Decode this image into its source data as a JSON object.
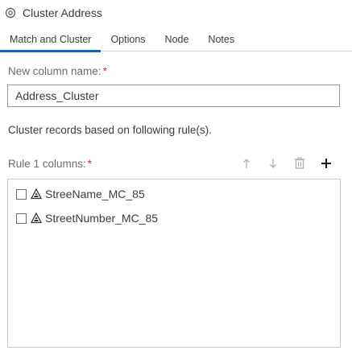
{
  "header": {
    "title": "Cluster Address",
    "icon": "cluster-node-icon"
  },
  "tabs": [
    {
      "label": "Match and Cluster",
      "active": true
    },
    {
      "label": "Options",
      "active": false
    },
    {
      "label": "Node",
      "active": false
    },
    {
      "label": "Notes",
      "active": false
    }
  ],
  "form": {
    "column_name_label": "New column name:",
    "column_name_value": "Address_Cluster",
    "required_mark": "*",
    "description": "Cluster records based on following rule(s).",
    "rule_label": "Rule 1 columns:",
    "rule_required_mark": "*"
  },
  "toolbar": {
    "move_up_icon": "arrow-up-icon",
    "move_down_icon": "arrow-down-icon",
    "delete_icon": "trash-icon",
    "add_icon": "plus-icon"
  },
  "rule_columns": [
    {
      "name": "StreeName_MC_85",
      "checked": false,
      "icon": "matchcode-icon"
    },
    {
      "name": "StreetNumber_MC_85",
      "checked": false,
      "icon": "matchcode-icon"
    }
  ],
  "colors": {
    "accent": "#0b66c7",
    "required": "#d52b1e"
  }
}
